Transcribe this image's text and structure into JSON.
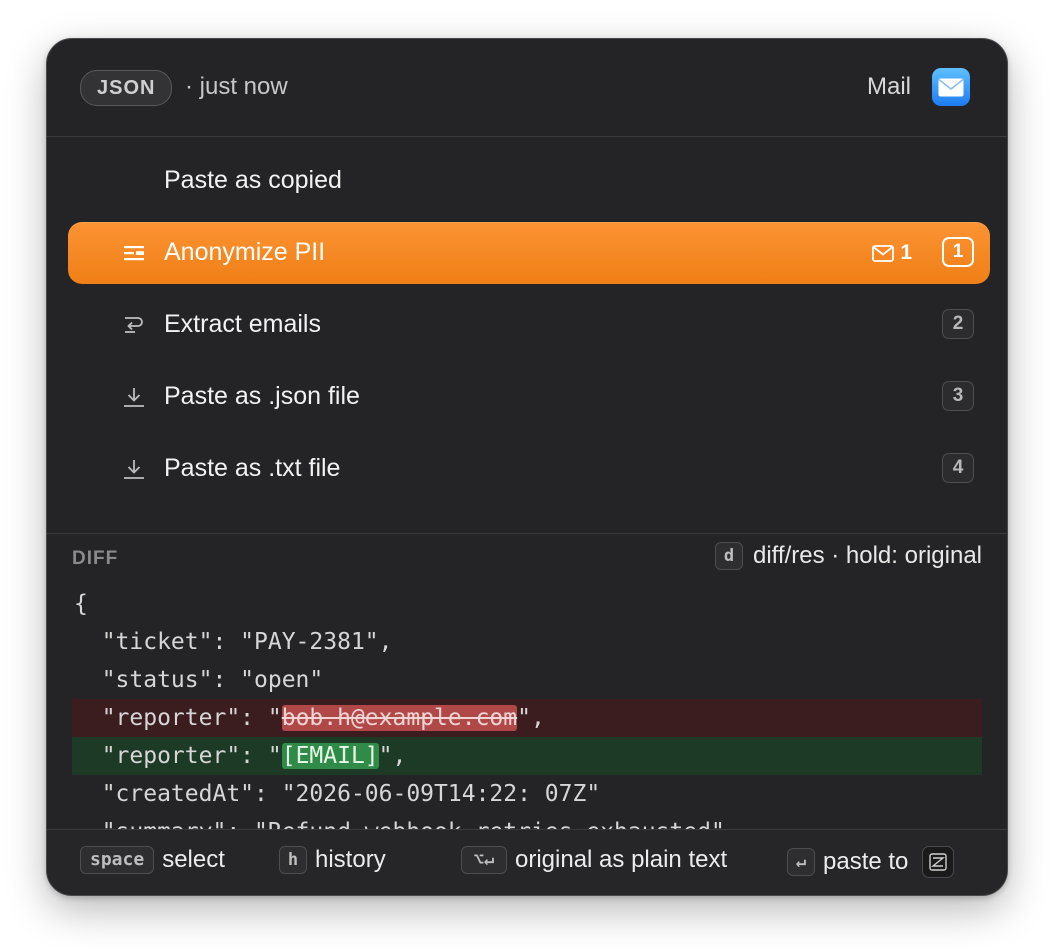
{
  "header": {
    "format_badge": "JSON",
    "timestamp": "· just now",
    "target_app": "Mail",
    "target_app_icon": "mail-app-icon"
  },
  "menu": {
    "items": [
      {
        "label": "Paste as copied",
        "icon": "",
        "shortcut": "",
        "selected": false
      },
      {
        "label": "Anonymize PII",
        "icon": "redact-lines-icon",
        "shortcut": "1",
        "selected": true,
        "badge_icon": "envelope-icon",
        "badge_count": "1"
      },
      {
        "label": "Extract emails",
        "icon": "wrap-arrow-icon",
        "shortcut": "2",
        "selected": false
      },
      {
        "label": "Paste as .json file",
        "icon": "download-icon",
        "shortcut": "3",
        "selected": false
      },
      {
        "label": "Paste as .txt file",
        "icon": "download-icon",
        "shortcut": "4",
        "selected": false
      }
    ]
  },
  "diff": {
    "title": "DIFF",
    "hint_key": "d",
    "hint_text": "diff/res · hold: original",
    "lines": {
      "l1": "{",
      "l2": "  \"ticket\": \"PAY-2381\",",
      "l3": "  \"status\": \"open\"",
      "l4_pre": "  \"reporter\": \"",
      "l4_removed": "bob.h@example.com",
      "l4_post": "\",",
      "l5_pre": "  \"reporter\": \"",
      "l5_added": "[EMAIL]",
      "l5_post": "\",",
      "l6": "  \"createdAt\": \"2026-06-09T14:22: 07Z\"",
      "l7": "  \"summary\": \"Refund webhook retries exhausted\""
    }
  },
  "footer": {
    "items": [
      {
        "key": "space",
        "label": "select"
      },
      {
        "key": "h",
        "label": "history"
      },
      {
        "key": "⌥↵",
        "label": "original as plain text"
      },
      {
        "key": "↵",
        "label": "paste to"
      }
    ],
    "target_icon": "target-app-icon"
  },
  "colors": {
    "accent": "#F38A22",
    "panel_bg": "#242426",
    "removed_bg": "#3C1D1F",
    "added_bg": "#1C3A25"
  }
}
